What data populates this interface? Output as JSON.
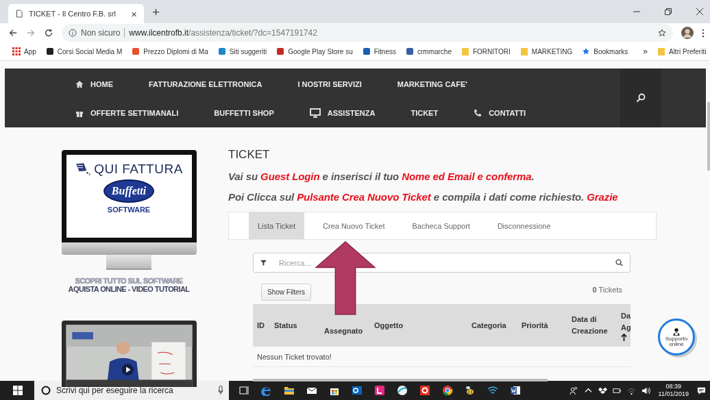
{
  "browser": {
    "tab_title": "TICKET - Il Centro F.B. srl",
    "tab_close": "×",
    "new_tab": "+",
    "security": "Non sicuro",
    "url_host": "www.ilcentrofb.it",
    "url_path": "/assistenza/ticket/?dc=1547191742",
    "bookmarks": [
      {
        "label": "App",
        "kind": "apps",
        "color": "#d93025"
      },
      {
        "label": "Corsi Social Media M",
        "kind": "site",
        "color": "#222222"
      },
      {
        "label": "Prezzo Diplomi di Ma",
        "kind": "site",
        "color": "#e8512a"
      },
      {
        "label": "Siti suggeriti",
        "kind": "site",
        "color": "#1e88c8"
      },
      {
        "label": "Google Play Store su",
        "kind": "site",
        "color": "#c62828"
      },
      {
        "label": "Fitness",
        "kind": "site",
        "color": "#1a5fb4"
      },
      {
        "label": "crmmarche",
        "kind": "site",
        "color": "#3b5ea8"
      },
      {
        "label": "FORNITORI",
        "kind": "folder",
        "color": "#f4c542"
      },
      {
        "label": "MARKETING",
        "kind": "folder",
        "color": "#f4c542"
      },
      {
        "label": "Bookmarks",
        "kind": "star",
        "color": "#1a73e8"
      }
    ],
    "more": "»",
    "other": "Altri Preferiti"
  },
  "nav": {
    "rows": [
      [
        {
          "label": "HOME",
          "kind": "home"
        },
        {
          "label": "FATTURAZIONE ELETTRONICA",
          "kind": "text"
        },
        {
          "label": "I NOSTRI SERVIZI",
          "kind": "text"
        },
        {
          "label": "MARKETING CAFE'",
          "kind": "text"
        }
      ],
      [
        {
          "label": "OFFERTE SETTIMANALI",
          "kind": "gift"
        },
        {
          "label": "BUFFETTI SHOP",
          "kind": "text"
        },
        {
          "label": "ASSISTENZA",
          "kind": "monitor"
        },
        {
          "label": "TICKET",
          "kind": "text"
        },
        {
          "label": "CONTATTI",
          "kind": "phone"
        }
      ]
    ]
  },
  "sidebar": {
    "banner": {
      "title": "QUI FATTURA",
      "logo": "Buffetti",
      "subtitle": "SOFTWARE"
    },
    "caption": [
      "SCOPRI TUTTO SUL SOFTWARE",
      "AQUISTA ONLINE - VIDEO TUTORIAL"
    ]
  },
  "main": {
    "title": "TICKET",
    "instructions": [
      [
        {
          "text": "Vai su ",
          "highlight": false
        },
        {
          "text": "Guest Login",
          "highlight": true
        },
        {
          "text": " e inserisci il tuo ",
          "highlight": false
        },
        {
          "text": "Nome ed Email e conferma",
          "highlight": true
        },
        {
          "text": ".",
          "highlight": false
        }
      ],
      [
        {
          "text": "Poi Clicca sul ",
          "highlight": false
        },
        {
          "text": "Pulsante Crea Nuovo Ticket",
          "highlight": true
        },
        {
          "text": " e compila i dati come richiesto. ",
          "highlight": false
        },
        {
          "text": "Grazie",
          "highlight": true
        }
      ]
    ],
    "tabs": [
      {
        "label": "Lista Ticket",
        "selected": true
      },
      {
        "label": "Crea Nuovo Ticket",
        "selected": false
      },
      {
        "label": "Bacheca Support",
        "selected": false
      },
      {
        "label": "Disconnessione",
        "selected": false
      }
    ],
    "search": {
      "placeholder": "Ricerca..."
    },
    "show_filters": "Show Filters",
    "count": "**0** Tickets",
    "columns": [
      {
        "label": "ID",
        "sorted": false
      },
      {
        "label": "Status",
        "sorted": false
      },
      {
        "label": "Assegnato",
        "sorted": false
      },
      {
        "label": "Oggetto",
        "sorted": false
      },
      {
        "label": "Categoria",
        "sorted": false
      },
      {
        "label": "Priorità",
        "sorted": false
      },
      {
        "label": "Data di Creazione",
        "sorted": false
      },
      {
        "label": "Da Ag",
        "sorted": true
      }
    ],
    "empty": "Nessun Ticket trovato!"
  },
  "support": {
    "label": "Supporto online"
  },
  "taskbar": {
    "search_placeholder": "Scrivi qui per eseguire la ricerca",
    "apps": [
      {
        "kind": "taskview"
      },
      {
        "kind": "edge"
      },
      {
        "kind": "folder"
      },
      {
        "kind": "mail"
      },
      {
        "kind": "store"
      },
      {
        "kind": "outlook"
      },
      {
        "kind": "pink"
      },
      {
        "kind": "disc"
      },
      {
        "kind": "red"
      },
      {
        "kind": "chrome"
      },
      {
        "kind": "bee"
      },
      {
        "kind": "wifi"
      },
      {
        "kind": "word"
      }
    ],
    "time": "08:39",
    "date": "11/01/2019"
  }
}
